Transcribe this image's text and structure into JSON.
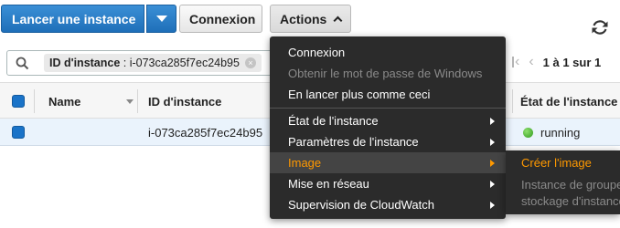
{
  "toolbar": {
    "launch_label": "Lancer une instance",
    "connect_label": "Connexion",
    "actions_label": "Actions"
  },
  "search": {
    "token_key": "ID d'instance",
    "token_sep": " : ",
    "token_value": "i-073ca285f7ec24b95",
    "token_close": "×"
  },
  "pager": {
    "range_text": "1 à 1 sur 1"
  },
  "table": {
    "columns": {
      "name": "Name",
      "instance_id": "ID d'instance",
      "state": "État de l'instance"
    },
    "rows": [
      {
        "name": "",
        "instance_id": "i-073ca285f7ec24b95",
        "state": "running"
      }
    ]
  },
  "actions_menu": {
    "items": [
      {
        "label": "Connexion",
        "state": "enabled"
      },
      {
        "label": "Obtenir le mot de passe de Windows",
        "state": "disabled"
      },
      {
        "label": "En lancer plus comme ceci",
        "state": "enabled"
      },
      {
        "label": "État de l'instance",
        "state": "submenu"
      },
      {
        "label": "Paramètres de l'instance",
        "state": "submenu"
      },
      {
        "label": "Image",
        "state": "submenu-active"
      },
      {
        "label": "Mise en réseau",
        "state": "submenu"
      },
      {
        "label": "Supervision de CloudWatch",
        "state": "submenu"
      }
    ]
  },
  "image_submenu": {
    "items": [
      {
        "label": "Créer l'image",
        "state": "highlighted"
      },
      {
        "label": "Instance de groupe",
        "state": "disabled"
      },
      {
        "label": "stockage d'instance",
        "state": "disabled"
      }
    ]
  },
  "colors": {
    "primary_blue": "#1f6fb9",
    "menu_bg": "#2b2b2b",
    "menu_highlight": "#ff9900",
    "row_selected": "#eaf3fc",
    "running_green": "#2f9a1c"
  },
  "icons": {
    "refresh": "refresh-icon",
    "search": "search-icon",
    "pager_first": "first-page-icon",
    "pager_prev": "previous-page-icon"
  }
}
